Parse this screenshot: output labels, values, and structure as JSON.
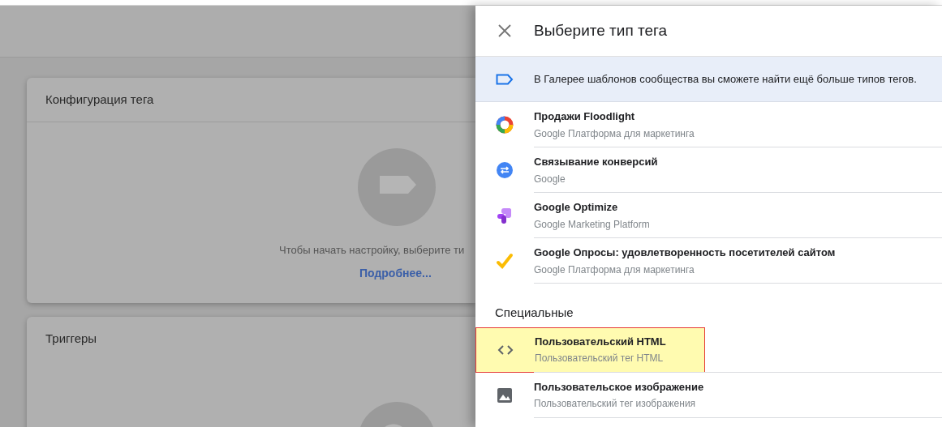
{
  "background": {
    "cards": [
      {
        "title": "Конфигурация тега",
        "kind": "tag",
        "hint": "Чтобы начать настройку, выберите ти",
        "link": "Подробнее..."
      },
      {
        "title": "Триггеры",
        "kind": "trigger"
      }
    ]
  },
  "panel": {
    "title": "Выберите тип тега",
    "banner": "В Галерее шаблонов сообщества вы сможете найти ещё больше типов тегов.",
    "groups": [
      {
        "items": [
          {
            "kind": "floodlight",
            "title": "Продажи Floodlight",
            "subtitle": "Google Платформа для маркетинга",
            "selected": false
          },
          {
            "kind": "linker",
            "title": "Связывание конверсий",
            "subtitle": "Google",
            "selected": false
          },
          {
            "kind": "optimize",
            "title": "Google Optimize",
            "subtitle": "Google Marketing Platform",
            "selected": false
          },
          {
            "kind": "surveys",
            "title": "Google Опросы: удовлетворенность посетителей сайтом",
            "subtitle": "Google Платформа для маркетинга",
            "selected": false
          }
        ]
      },
      {
        "heading": "Специальные",
        "items": [
          {
            "kind": "code",
            "title": "Пользовательский HTML",
            "subtitle": "Пользовательский тег HTML",
            "selected": true
          },
          {
            "kind": "image",
            "title": "Пользовательское изображение",
            "subtitle": "Пользовательский тег изображения",
            "selected": false
          }
        ]
      }
    ]
  }
}
